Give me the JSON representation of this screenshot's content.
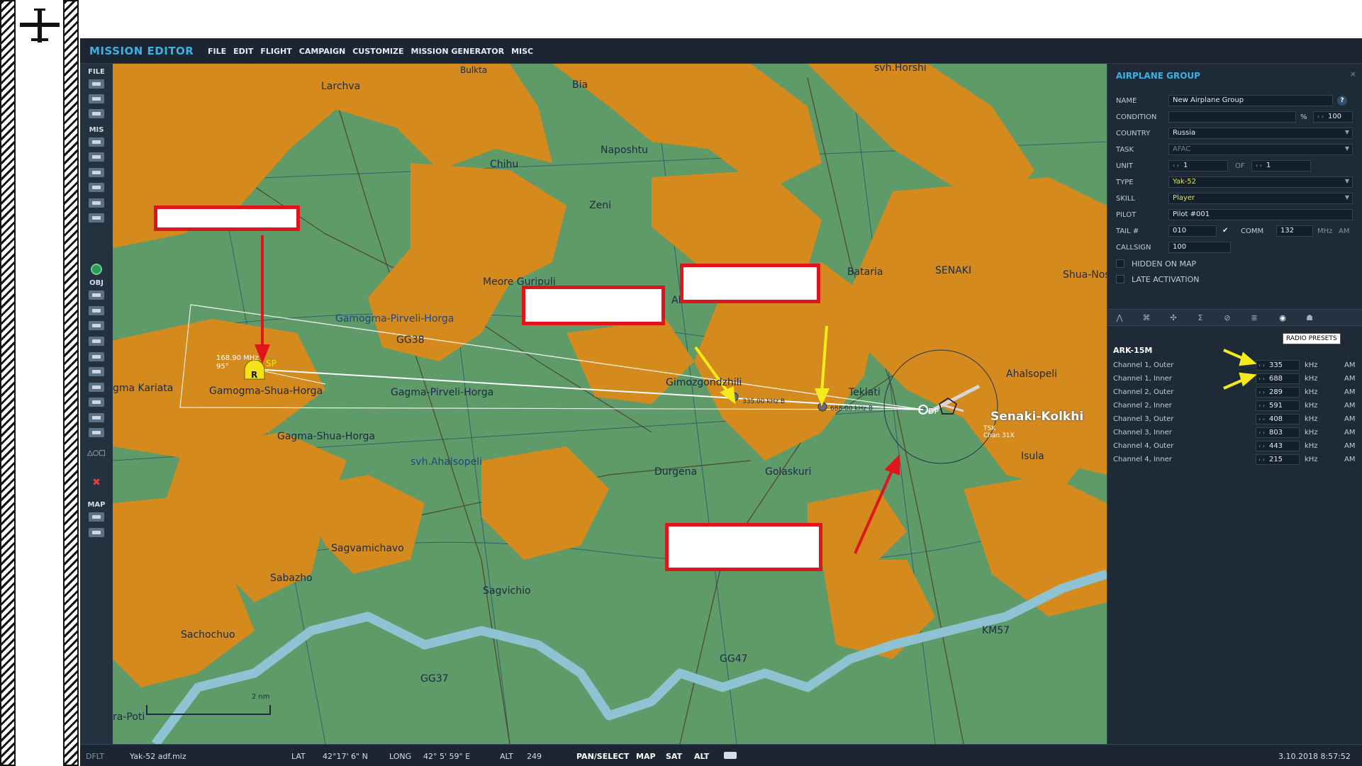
{
  "window": {
    "title": "MISSION EDITOR",
    "menu": [
      "FILE",
      "EDIT",
      "FLIGHT",
      "CAMPAIGN",
      "CUSTOMIZE",
      "MISSION GENERATOR",
      "MISC"
    ]
  },
  "toolbar": {
    "sections": [
      "FILE",
      "MIS",
      "OBJ",
      "MAP"
    ],
    "tool_shapes": "△○□"
  },
  "map": {
    "labels": [
      "Bulkta",
      "Larchva",
      "Bia",
      "svh.Horshi",
      "Chihu",
      "Naposhtu",
      "Zeni",
      "Meore Guripuli",
      "Aliani",
      "Bataria",
      "SENAKI",
      "Shua-Nos",
      "Gamogma-Pirveli-Horga",
      "GG38",
      "Gamogma-Shua-Horga",
      "Gagma-Pirveli-Horga",
      "Gagma-Shua-Horga",
      "gma Kariata",
      "Gimozgondzhili",
      "Teklati",
      "Ahalsopeli",
      "svh.Ahalsopeli",
      "Durgena",
      "Golaskuri",
      "Isula",
      "Sagvamichavo",
      "Sabazho",
      "Sagvichio",
      "Sachochuo",
      "GG37",
      "GG47",
      "KM57",
      "ra-Poti"
    ],
    "airfield": "Senaki-Kolkhi",
    "airfield_sub": [
      "TSK",
      "Chan 31X"
    ],
    "sp_freq": "168.90 MHz",
    "sp_heading": "95°",
    "sp_label": "SP",
    "sp_marker": "R",
    "ndb_outer": "335.00 kHz B",
    "ndb_inner": "688.00 kHz B",
    "dp_label": "DP",
    "scale": "2 nm"
  },
  "panel": {
    "title": "AIRPLANE GROUP",
    "close": "×",
    "fields": {
      "name_label": "NAME",
      "name_value": "New Airplane Group",
      "help": "?",
      "condition_label": "CONDITION",
      "condition_pct": "%",
      "condition_value": "100",
      "country_label": "COUNTRY",
      "country_value": "Russia",
      "task_label": "TASK",
      "task_value": "AFAC",
      "unit_label": "UNIT",
      "unit_value": "1",
      "unit_of": "OF",
      "unit_total": "1",
      "type_label": "TYPE",
      "type_value": "Yak-52",
      "skill_label": "SKILL",
      "skill_value": "Player",
      "pilot_label": "PILOT",
      "pilot_value": "Pilot #001",
      "tail_label": "TAIL #",
      "tail_value": "010",
      "comm_label": "COMM",
      "comm_value": "132",
      "comm_unit": "MHz",
      "comm_mod": "AM",
      "callsign_label": "CALLSIGN",
      "callsign_value": "100",
      "hidden_label": "HIDDEN ON MAP",
      "late_label": "LATE ACTIVATION"
    },
    "tooltip": "RADIO PRESETS",
    "radio": {
      "name": "ARK-15M",
      "channels": [
        {
          "name": "Channel 1, Outer",
          "value": "335",
          "unit": "kHz",
          "mod": "AM"
        },
        {
          "name": "Channel 1, Inner",
          "value": "688",
          "unit": "kHz",
          "mod": "AM"
        },
        {
          "name": "Channel 2, Outer",
          "value": "289",
          "unit": "kHz",
          "mod": "AM"
        },
        {
          "name": "Channel 2, Inner",
          "value": "591",
          "unit": "kHz",
          "mod": "AM"
        },
        {
          "name": "Channel 3, Outer",
          "value": "408",
          "unit": "kHz",
          "mod": "AM"
        },
        {
          "name": "Channel 3, Inner",
          "value": "803",
          "unit": "kHz",
          "mod": "AM"
        },
        {
          "name": "Channel 4, Outer",
          "value": "443",
          "unit": "kHz",
          "mod": "AM"
        },
        {
          "name": "Channel 4, Inner",
          "value": "215",
          "unit": "kHz",
          "mod": "AM"
        }
      ]
    }
  },
  "status": {
    "profile": "DFLT",
    "file": "Yak-52 adf.miz",
    "lat_label": "LAT",
    "lat_value": "42°17' 6\" N",
    "long_label": "LONG",
    "long_value": "42° 5' 59\" E",
    "alt_label": "ALT",
    "alt_value": "249",
    "modes": [
      "PAN/SELECT",
      "MAP",
      "SAT",
      "ALT"
    ],
    "datetime": "3.10.2018 8:57:52"
  },
  "colors": {
    "terrain": "#5f9a69",
    "urban": "#d48a1c",
    "river": "#8dc3d3",
    "accent": "#3fb0e6",
    "annotation_red": "#e0141b",
    "annotation_yellow": "#f3ec1a"
  }
}
